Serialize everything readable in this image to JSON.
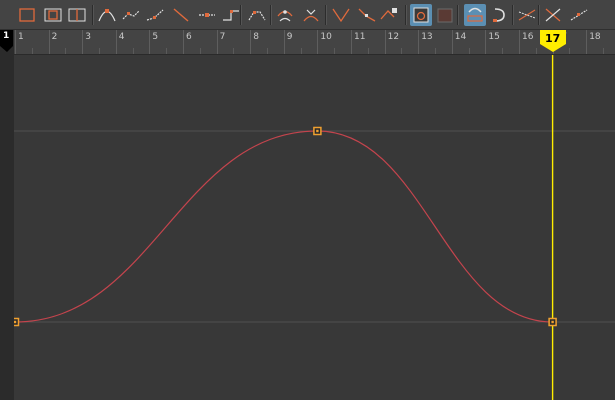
{
  "toolbar": {
    "buttons": [
      {
        "icon": "frame-all-icon"
      },
      {
        "icon": "frame-selection-icon"
      },
      {
        "icon": "frame-playback-range-icon"
      },
      {
        "icon": "tangent-spline-icon"
      },
      {
        "icon": "tangent-clamped-icon"
      },
      {
        "icon": "tangent-linear-icon"
      },
      {
        "icon": "tangent-flat-icon"
      },
      {
        "icon": "tangent-step-icon"
      },
      {
        "icon": "tangent-plateau-icon"
      },
      {
        "icon": "break-tangents-icon"
      },
      {
        "icon": "unify-tangents-icon"
      },
      {
        "icon": "free-tangent-weight-icon"
      },
      {
        "icon": "lock-tangent-weight-icon"
      },
      {
        "icon": "normalize-icon"
      },
      {
        "icon": "lock-icon"
      },
      {
        "icon": "buffer-curve-icon",
        "active": true
      },
      {
        "icon": "buffer-swap-icon"
      },
      {
        "icon": "snap-time-icon",
        "active": true
      },
      {
        "icon": "magnet-icon"
      },
      {
        "icon": "pre-infinity-icon"
      },
      {
        "icon": "post-infinity-icon"
      },
      {
        "icon": "cycle-offset-icon"
      }
    ]
  },
  "timeline": {
    "start_frame": "1",
    "current_frame": "17",
    "frame_labels": [
      "1",
      "2",
      "3",
      "4",
      "5",
      "6",
      "7",
      "8",
      "9",
      "10",
      "11",
      "12",
      "13",
      "14",
      "15",
      "16",
      "17",
      "18"
    ]
  },
  "curve": {
    "keys": [
      {
        "frame": 1,
        "value": 0
      },
      {
        "frame": 10,
        "value": 1
      },
      {
        "frame": 17,
        "value": 0
      }
    ],
    "curve_color": "#c4444d",
    "key_color": "#f0a030",
    "playhead_color": "#ffee00"
  }
}
